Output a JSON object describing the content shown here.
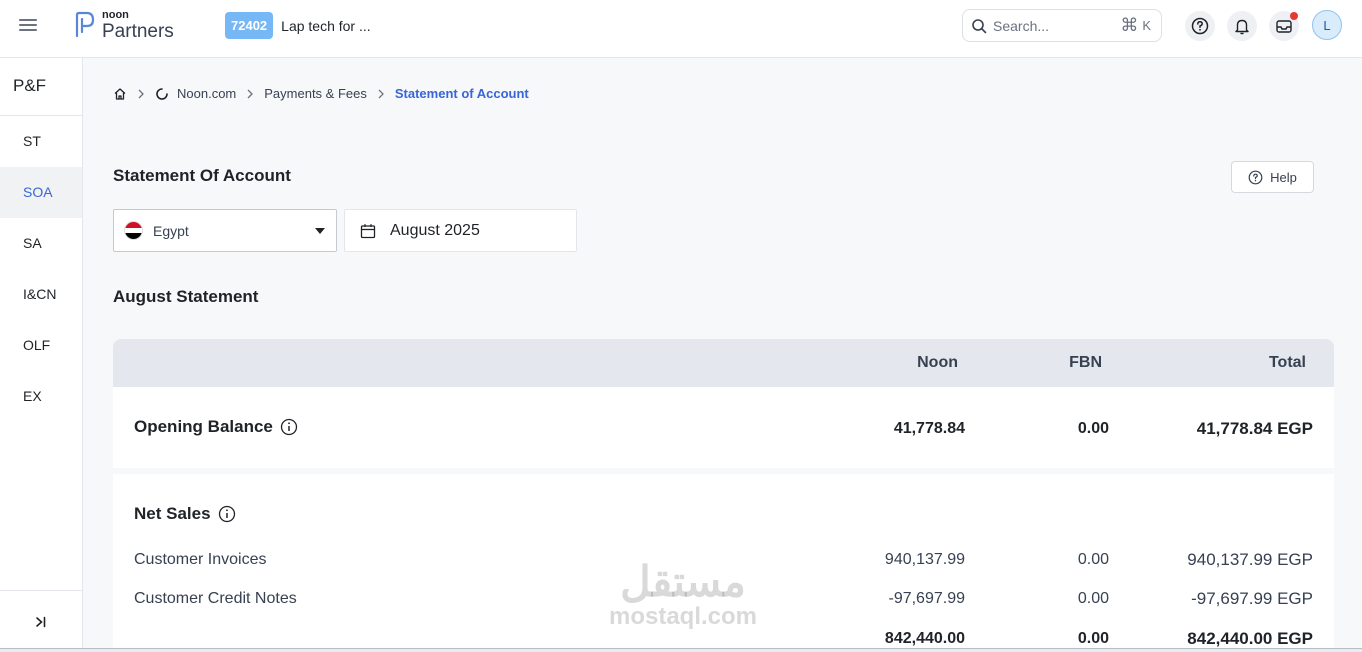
{
  "header": {
    "logo_small": "noon",
    "logo_big": "Partners",
    "store_id": "72402",
    "store_name": "Lap tech for ...",
    "search_placeholder": "Search...",
    "search_shortcut": "K",
    "avatar_initial": "L",
    "icons": [
      "menu-icon",
      "search-icon",
      "help-icon",
      "bell-icon",
      "inbox-icon"
    ]
  },
  "sidebar": {
    "title": "P&F",
    "items": [
      {
        "label": "ST"
      },
      {
        "label": "SOA"
      },
      {
        "label": "SA"
      },
      {
        "label": "I&CN"
      },
      {
        "label": "OLF"
      },
      {
        "label": "EX"
      }
    ],
    "active": "SOA"
  },
  "breadcrumb": {
    "items": [
      "Noon.com",
      "Payments & Fees"
    ],
    "current": "Statement of Account"
  },
  "page": {
    "title": "Statement Of Account",
    "help_label": "Help",
    "country": "Egypt",
    "month": "August 2025",
    "section_title": "August Statement"
  },
  "table": {
    "columns": [
      "Noon",
      "FBN",
      "Total"
    ],
    "opening_balance": {
      "label": "Opening Balance",
      "noon": "41,778.84",
      "fbn": "0.00",
      "total": "41,778.84 EGP"
    },
    "net_sales": {
      "label": "Net Sales",
      "rows": [
        {
          "label": "Customer Invoices",
          "noon": "940,137.99",
          "fbn": "0.00",
          "total": "940,137.99 EGP"
        },
        {
          "label": "Customer Credit Notes",
          "noon": "-97,697.99",
          "fbn": "0.00",
          "total": "-97,697.99 EGP"
        }
      ],
      "subtotal": {
        "noon": "842,440.00",
        "fbn": "0.00",
        "total": "842,440.00 EGP"
      }
    }
  },
  "watermark": {
    "arabic": "مستقل",
    "latin": "mostaql.com"
  },
  "colors": {
    "accent": "#3866d6",
    "badge": "#76b7f5",
    "notification": "#e53935"
  }
}
